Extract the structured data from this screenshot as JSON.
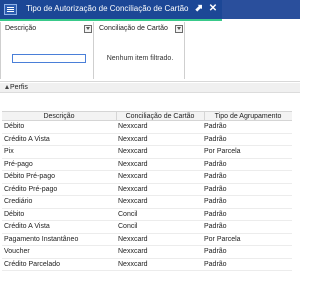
{
  "window": {
    "title": "Tipo de Autorização de Conciliação de Cartão",
    "restore_glyph": "⬈",
    "close_glyph": "✕",
    "app_icon": "list-window-icon"
  },
  "filters": {
    "descricao_label": "Descrição",
    "descricao_value": "",
    "conciliacao_label": "Conciliação de Cartão",
    "conciliacao_empty": "Nenhum item filtrado.",
    "filter_icon": "filter-icon"
  },
  "perfis": {
    "label": "Perfis",
    "icon": "triangle-up-icon"
  },
  "grid": {
    "columns": [
      "Descrição",
      "Conciliação de Cartão",
      "Tipo de Agrupamento"
    ],
    "rows": [
      [
        "Débito",
        "Nexxcard",
        "Padrão"
      ],
      [
        "Crédito A Vista",
        "Nexxcard",
        "Padrão"
      ],
      [
        "Pix",
        "Nexxcard",
        "Por Parcela"
      ],
      [
        "Pré-pago",
        "Nexxcard",
        "Padrão"
      ],
      [
        "Débito Pré-pago",
        "Nexxcard",
        "Padrão"
      ],
      [
        "Crédito Pré-pago",
        "Nexxcard",
        "Padrão"
      ],
      [
        "Crediário",
        "Nexxcard",
        "Padrão"
      ],
      [
        "Débito",
        "Concil",
        "Padrão"
      ],
      [
        "Crédito A Vista",
        "Concil",
        "Padrão"
      ],
      [
        "Pagamento Instantâneo",
        "Nexxcard",
        "Por Parcela"
      ],
      [
        "Voucher",
        "Nexxcard",
        "Padrão"
      ],
      [
        "Crédito Parcelado",
        "Nexxcard",
        "Padrão"
      ]
    ]
  },
  "colors": {
    "titlebar": "#1c4796",
    "accent": "#39c98a",
    "search_border": "#4a7fd8"
  }
}
